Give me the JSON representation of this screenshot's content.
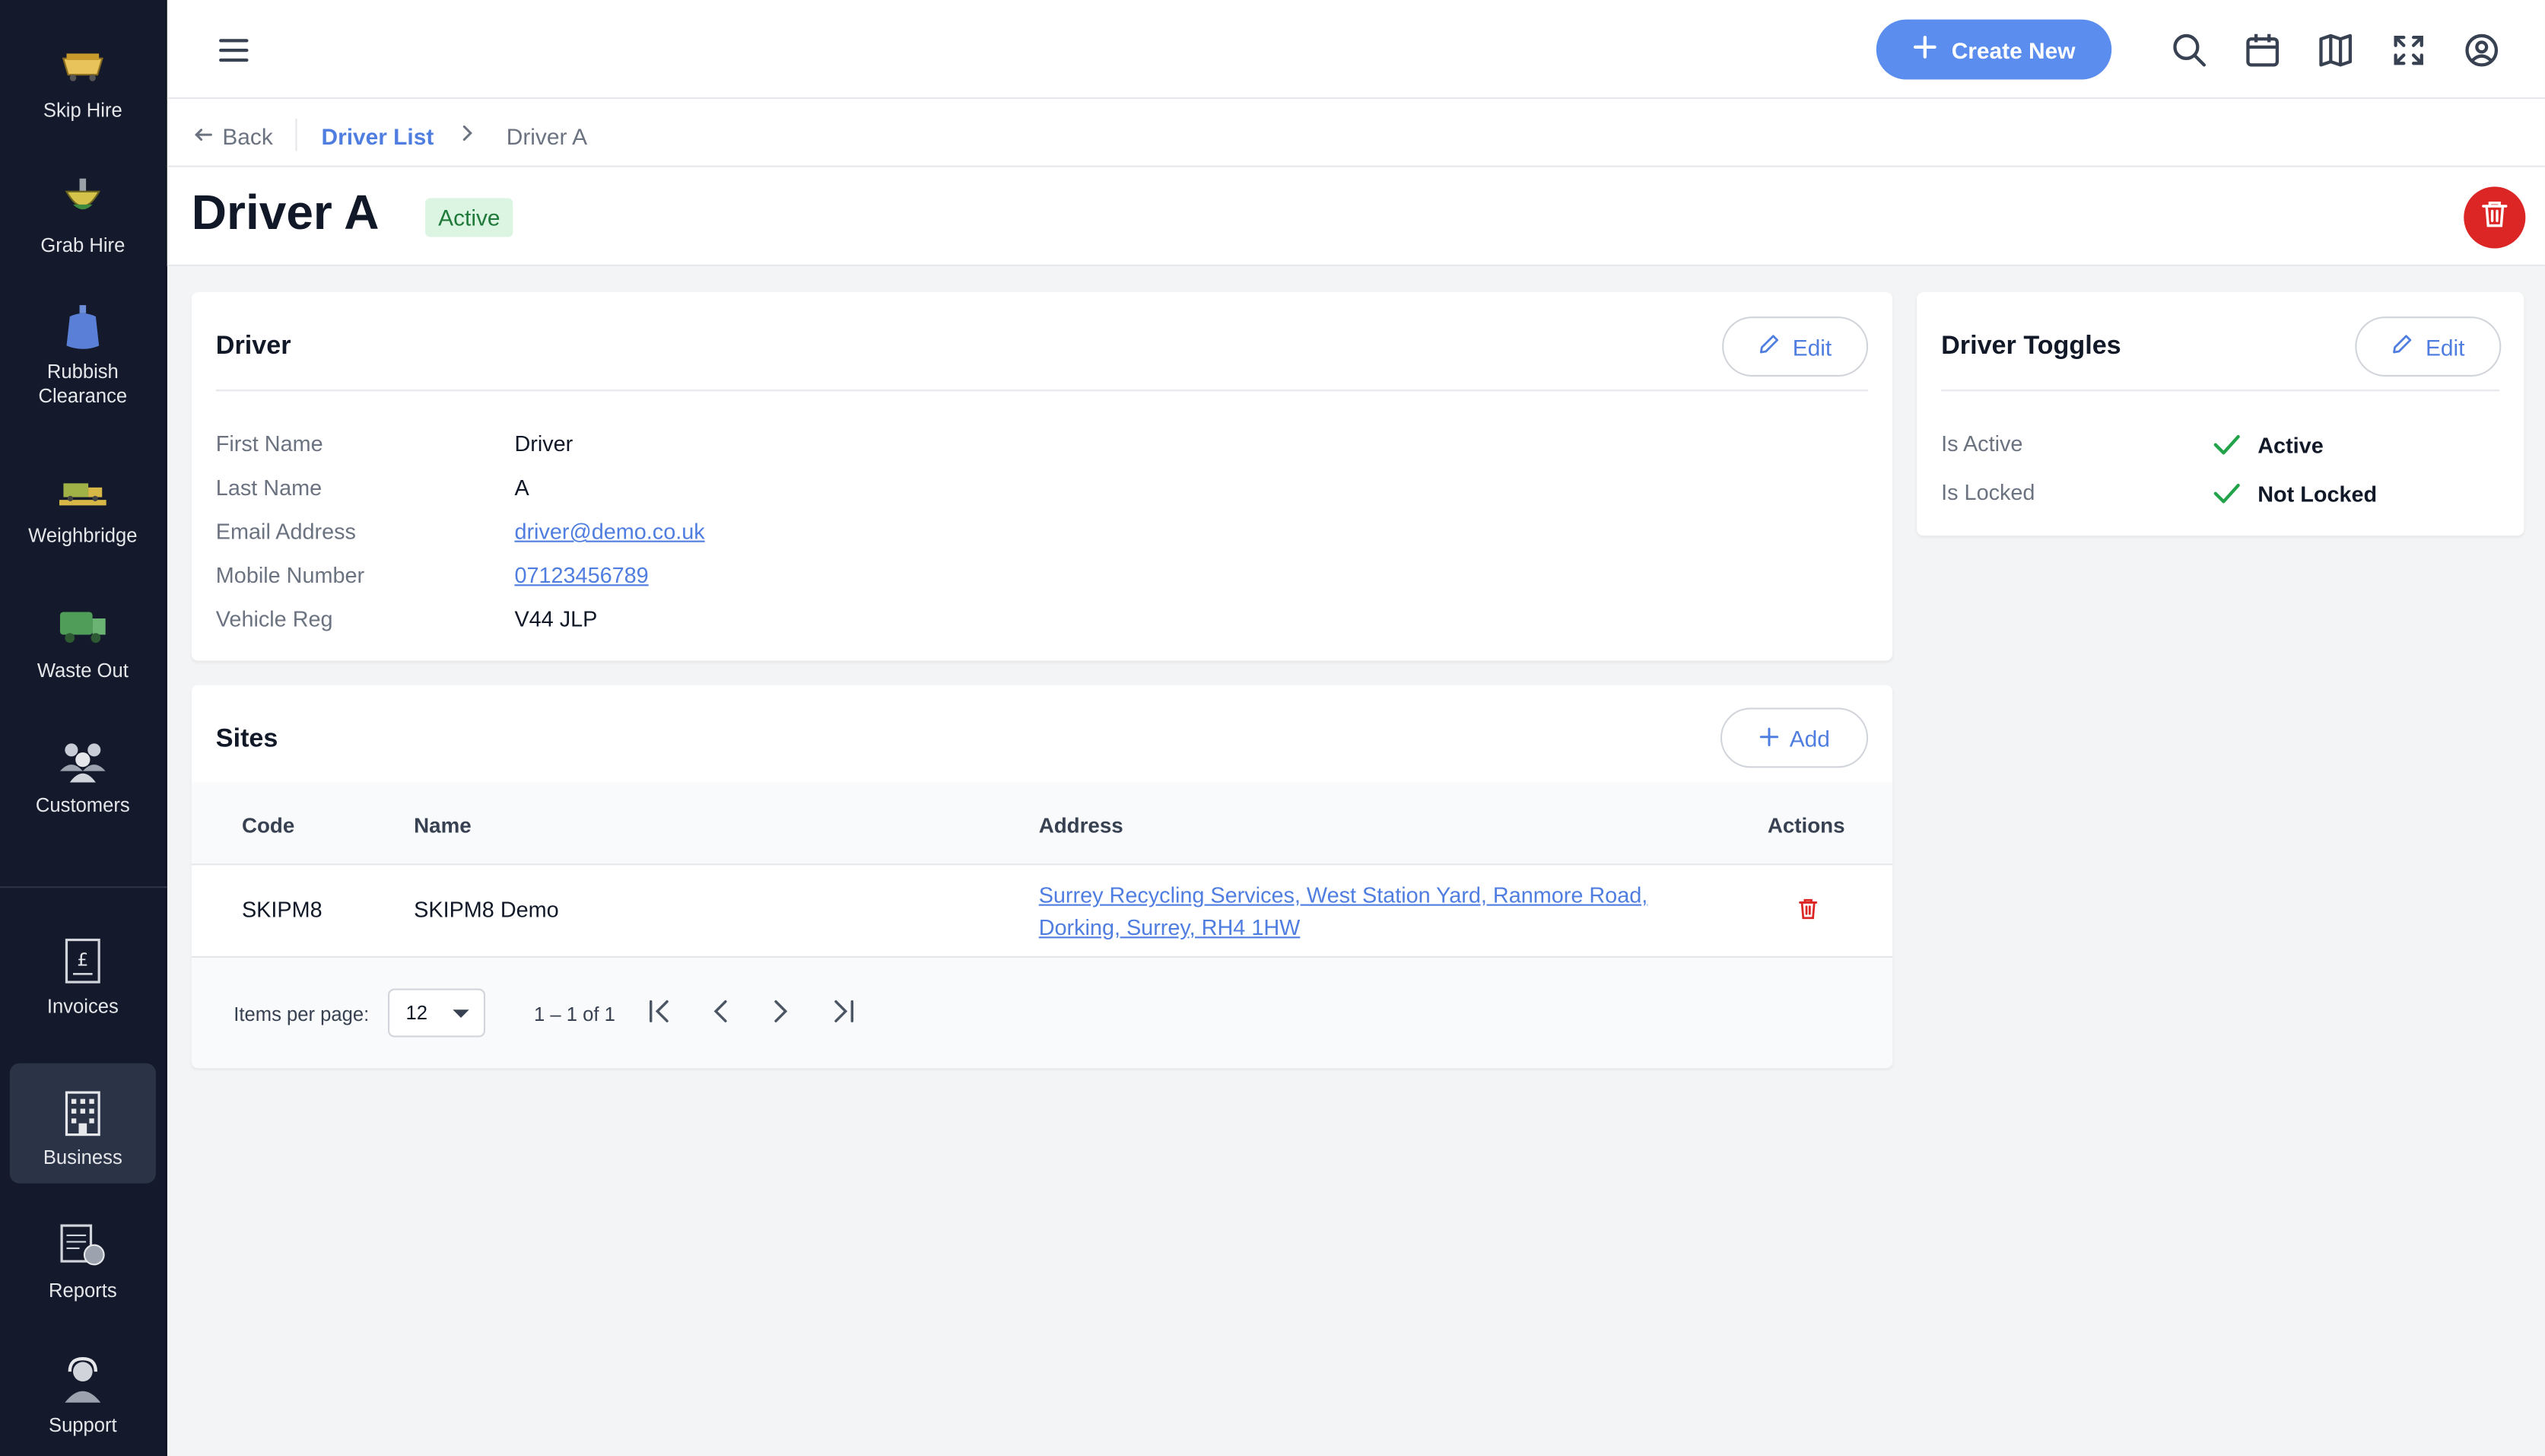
{
  "sidebar": {
    "items": [
      {
        "label": "Skip Hire",
        "icon": "skip-icon"
      },
      {
        "label": "Grab Hire",
        "icon": "grab-icon"
      },
      {
        "label": "Rubbish Clearance",
        "icon": "rubbish-bag-icon"
      },
      {
        "label": "Weighbridge",
        "icon": "weighbridge-icon"
      },
      {
        "label": "Waste Out",
        "icon": "waste-truck-icon"
      },
      {
        "label": "Customers",
        "icon": "customers-icon"
      },
      {
        "label": "Invoices",
        "icon": "invoice-icon"
      },
      {
        "label": "Business",
        "icon": "business-icon"
      },
      {
        "label": "Reports",
        "icon": "reports-icon"
      },
      {
        "label": "Support",
        "icon": "support-icon"
      }
    ],
    "active": "Business"
  },
  "topbar": {
    "create_label": "Create New"
  },
  "breadcrumb": {
    "back_label": "Back",
    "parent": "Driver List",
    "current": "Driver A"
  },
  "page": {
    "title": "Driver A",
    "status": "Active"
  },
  "driver_card": {
    "title": "Driver",
    "edit_label": "Edit",
    "fields": [
      {
        "label": "First Name",
        "value": "Driver"
      },
      {
        "label": "Last Name",
        "value": "A"
      },
      {
        "label": "Email Address",
        "value": "driver@demo.co.uk"
      },
      {
        "label": "Mobile Number",
        "value": "07123456789"
      },
      {
        "label": "Vehicle Reg",
        "value": "V44 JLP"
      }
    ]
  },
  "toggles_card": {
    "title": "Driver Toggles",
    "edit_label": "Edit",
    "rows": [
      {
        "label": "Is Active",
        "value": "Active"
      },
      {
        "label": "Is Locked",
        "value": "Not Locked"
      }
    ]
  },
  "sites_card": {
    "title": "Sites",
    "add_label": "Add",
    "columns": [
      "Code",
      "Name",
      "Address",
      "Actions"
    ],
    "rows": [
      {
        "code": "SKIPM8",
        "name": "SKIPM8 Demo",
        "address_line1": "Surrey Recycling Services, West Station Yard, Ranmore Road,",
        "address_line2": "Dorking, Surrey, RH4 1HW"
      }
    ],
    "pager": {
      "items_per_page_label": "Items per page:",
      "page_size": "12",
      "range": "1 – 1 of 1"
    }
  },
  "colors": {
    "sidebar_bg": "#141a2b",
    "accent": "#5b8def",
    "danger": "#dc2626",
    "success": "#22a34a"
  }
}
